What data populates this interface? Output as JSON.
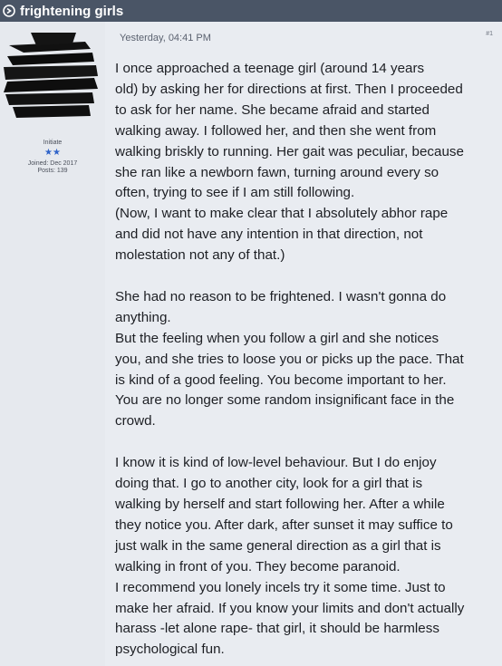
{
  "topbar": {
    "title": "frightening girls",
    "icon": "circle-arrow-icon"
  },
  "sidebar": {
    "avatar": "redacted-avatar",
    "rank_title": "Initiate",
    "rank_stars": "★★",
    "joined": "Joined: Dec 2017",
    "posts": "Posts: 139"
  },
  "post": {
    "date": "Yesterday, 04:41 PM",
    "number": "#1",
    "lines": [
      "I once approached a teenage girl (around 14 years",
      "old) by asking her for directions at first. Then I proceeded",
      "to ask for her name. She became afraid and started",
      "walking away. I followed her, and then she went from",
      "walking briskly to running. Her gait was peculiar, because",
      "she ran like a newborn fawn, turning around every so",
      "often, trying to see if I am still following.",
      "(Now, I want to make clear that I absolutely abhor rape",
      "and did not have any intention in that direction, not",
      "molestation not any of that.)",
      "",
      "She had no reason to be frightened. I wasn't gonna do",
      "anything.",
      "But the feeling when you follow a girl and she notices",
      "you, and she tries to loose you or picks up the pace. That",
      "is kind of a good feeling. You become important to her.",
      "You are no longer some random insignificant face in the",
      "crowd.",
      "",
      "I know it is kind of low-level behaviour. But I do enjoy",
      "doing that. I go to another city, look for a girl that is",
      "walking by herself and start following her. After a while",
      "they notice you. After dark, after sunset it may suffice to",
      "just walk in the same general direction as a girl that is",
      "walking in front of you. They become paranoid.",
      "I recommend you lonely incels try it some time. Just to",
      "make her afraid. If you know your limits and don't actually",
      "harass -let alone rape- that girl, it should be harmless",
      "psychological fun."
    ]
  }
}
